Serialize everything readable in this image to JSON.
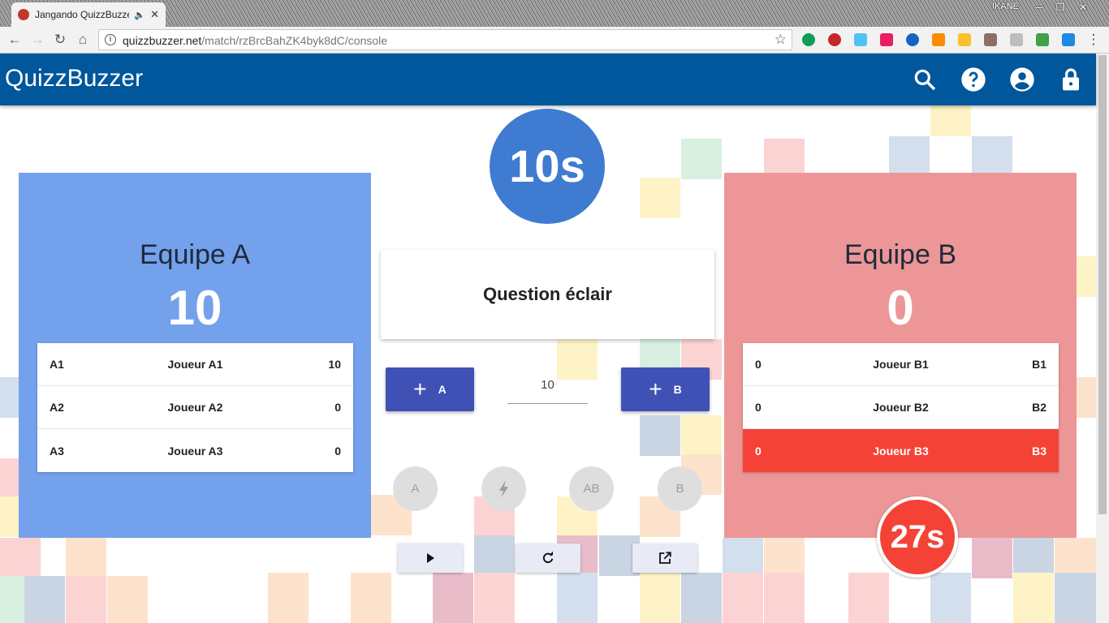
{
  "browser": {
    "tab_title": "Jangando QuizzBuzze",
    "window_user": "IKANE",
    "url_host": "quizzbuzzer.net",
    "url_path": "/match/rzBrcBahZK4byk8dC/console"
  },
  "app": {
    "brand": "QuizzBuzzer",
    "accent": "#01579b",
    "icons": [
      "search-icon",
      "help-icon",
      "account-icon",
      "lock-icon"
    ]
  },
  "timer_main": "10s",
  "question_title": "Question éclair",
  "points_value": "10",
  "add_a_label": "A",
  "add_b_label": "B",
  "buzzers": [
    "A",
    "AB",
    "B"
  ],
  "team_a": {
    "name": "Equipe A",
    "score": "10",
    "color": "#73a1ec",
    "players": [
      {
        "id": "A1",
        "name": "Joueur A1",
        "score": "10"
      },
      {
        "id": "A2",
        "name": "Joueur A2",
        "score": "0"
      },
      {
        "id": "A3",
        "name": "Joueur A3",
        "score": "0"
      }
    ]
  },
  "team_b": {
    "name": "Equipe B",
    "score": "0",
    "color": "#ed9697",
    "timer": "27s",
    "players": [
      {
        "score": "0",
        "name": "Joueur B1",
        "id": "B1"
      },
      {
        "score": "0",
        "name": "Joueur B2",
        "id": "B2"
      },
      {
        "score": "0",
        "name": "Joueur B3",
        "id": "B3",
        "active": true
      }
    ]
  },
  "controls": [
    "play-icon",
    "refresh-icon",
    "open-in-new-icon"
  ]
}
